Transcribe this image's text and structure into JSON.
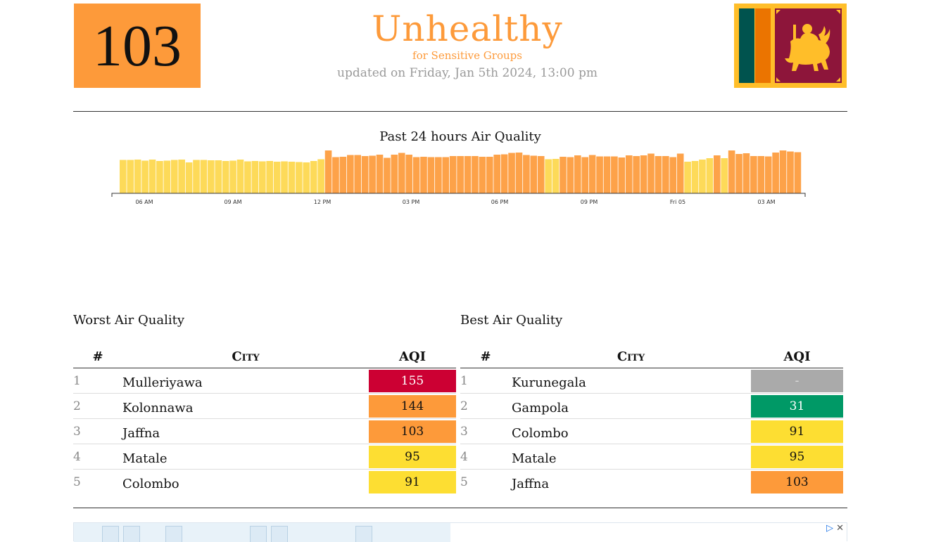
{
  "current": {
    "aqi": "103",
    "status": "Unhealthy",
    "status_sub": "for Sensitive Groups",
    "updated": "updated on Friday, Jan 5th 2024, 13:00 pm",
    "color": "#fd9a3a"
  },
  "flag": {
    "icon": "sri-lanka-flag"
  },
  "chart_data": {
    "type": "bar",
    "title": "Past 24 hours Air Quality",
    "x_ticks": [
      "06 AM",
      "09 AM",
      "12 PM",
      "03 PM",
      "06 PM",
      "09 PM",
      "Fri 05",
      "03 AM"
    ],
    "values": [
      95,
      95,
      96,
      93,
      96,
      92,
      93,
      95,
      96,
      88,
      95,
      95,
      94,
      94,
      92,
      93,
      96,
      91,
      92,
      91,
      92,
      90,
      91,
      90,
      89,
      88,
      92,
      97,
      122,
      103,
      104,
      109,
      109,
      106,
      107,
      110,
      101,
      110,
      115,
      110,
      103,
      104,
      103,
      103,
      103,
      106,
      106,
      106,
      106,
      104,
      104,
      110,
      111,
      115,
      116,
      109,
      107,
      106,
      97,
      98,
      104,
      103,
      108,
      103,
      109,
      105,
      105,
      105,
      102,
      108,
      106,
      108,
      113,
      106,
      106,
      103,
      113,
      90,
      92,
      96,
      100,
      108,
      100,
      122,
      112,
      114,
      106,
      106,
      105,
      116,
      122,
      119,
      117
    ],
    "ylim": [
      0,
      130
    ],
    "colors": {
      "moderate": "#fdd74b",
      "sensitive": "#fd9a3a"
    }
  },
  "worst": {
    "title": "Worst Air Quality",
    "headers": [
      "#",
      "City",
      "AQI"
    ],
    "rows": [
      {
        "rank": "1",
        "city": "Mulleriyawa",
        "aqi": "155",
        "color": "#cc0033",
        "text": "#ffffff"
      },
      {
        "rank": "2",
        "city": "Kolonnawa",
        "aqi": "144",
        "color": "#fd9a3a",
        "text": "#111111"
      },
      {
        "rank": "3",
        "city": "Jaffna",
        "aqi": "103",
        "color": "#fd9a3a",
        "text": "#111111"
      },
      {
        "rank": "4",
        "city": "Matale",
        "aqi": "95",
        "color": "#fdde32",
        "text": "#111111"
      },
      {
        "rank": "5",
        "city": "Colombo",
        "aqi": "91",
        "color": "#fdde32",
        "text": "#111111"
      }
    ]
  },
  "best": {
    "title": "Best Air Quality",
    "headers": [
      "#",
      "City",
      "AQI"
    ],
    "rows": [
      {
        "rank": "1",
        "city": "Kurunegala",
        "aqi": "-",
        "color": "#aaaaaa",
        "text": "#dddddd"
      },
      {
        "rank": "2",
        "city": "Gampola",
        "aqi": "31",
        "color": "#009966",
        "text": "#ffffff"
      },
      {
        "rank": "3",
        "city": "Colombo",
        "aqi": "91",
        "color": "#fdde32",
        "text": "#111111"
      },
      {
        "rank": "4",
        "city": "Matale",
        "aqi": "95",
        "color": "#fdde32",
        "text": "#111111"
      },
      {
        "rank": "5",
        "city": "Jaffna",
        "aqi": "103",
        "color": "#fd9a3a",
        "text": "#111111"
      }
    ]
  },
  "ad": {
    "icons": [
      "adchoices-icon",
      "close-icon"
    ]
  }
}
